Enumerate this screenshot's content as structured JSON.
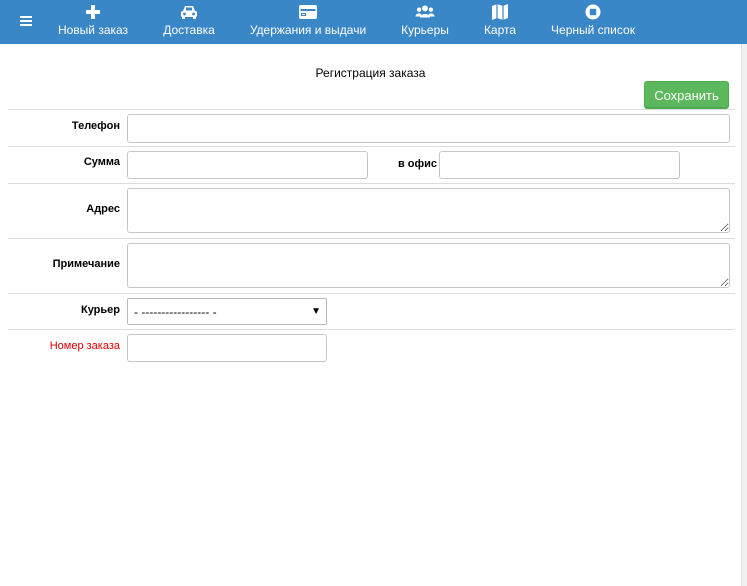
{
  "nav": {
    "menu_icon": "hamburger-icon",
    "items": [
      {
        "label": "Новый заказ",
        "icon": "plus-icon"
      },
      {
        "label": "Доставка",
        "icon": "car-icon"
      },
      {
        "label": "Удержания и выдачи",
        "icon": "credit-card-icon"
      },
      {
        "label": "Курьеры",
        "icon": "users-icon"
      },
      {
        "label": "Карта",
        "icon": "map-icon"
      },
      {
        "label": "Черный список",
        "icon": "stop-icon"
      }
    ],
    "bg_color": "#3a87c7"
  },
  "form": {
    "title": "Регистрация заказа",
    "save_label": "Сохранить",
    "save_color": "#5cb85c",
    "phone_label": "Телефон",
    "phone_value": "",
    "sum_label": "Сумма",
    "sum_value": "",
    "office_label": "в офис",
    "office_value": "",
    "address_label": "Адрес",
    "address_value": "",
    "note_label": "Примечание",
    "note_value": "",
    "courier_label": "Курьер",
    "courier_selected": "- ----------------- -",
    "order_number_label": "Номер заказа",
    "order_number_value": "",
    "order_number_color": "#dd0000"
  }
}
